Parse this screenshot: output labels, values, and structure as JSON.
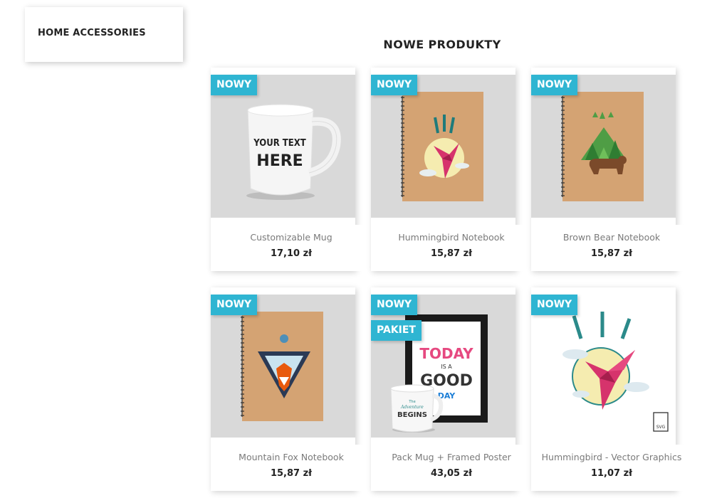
{
  "sidebar": {
    "category_label": "HOME ACCESSORIES"
  },
  "section": {
    "title": "NOWE PRODUKTY"
  },
  "colors": {
    "flag": "#2fb5d2",
    "thumb_bg": "#d9d9d9"
  },
  "products": [
    {
      "name": "Customizable Mug",
      "price": "17,10 zł",
      "flags": [
        "NOWY"
      ],
      "image_text": [
        "YOUR TEXT",
        "HERE"
      ]
    },
    {
      "name": "Hummingbird Notebook",
      "price": "15,87 zł",
      "flags": [
        "NOWY"
      ]
    },
    {
      "name": "Brown Bear Notebook",
      "price": "15,87 zł",
      "flags": [
        "NOWY"
      ]
    },
    {
      "name": "Mountain Fox Notebook",
      "price": "15,87 zł",
      "flags": [
        "NOWY"
      ]
    },
    {
      "name": "Pack Mug + Framed Poster",
      "price": "43,05 zł",
      "flags": [
        "NOWY",
        "PAKIET"
      ],
      "image_text": [
        "TODAY",
        "IS A",
        "GOOD",
        "DAY",
        "The",
        "Adventure",
        "BEGINS"
      ]
    },
    {
      "name": "Hummingbird - Vector Graphics",
      "price": "11,07 zł",
      "flags": [
        "NOWY"
      ],
      "image_text": [
        "SVG"
      ]
    }
  ]
}
